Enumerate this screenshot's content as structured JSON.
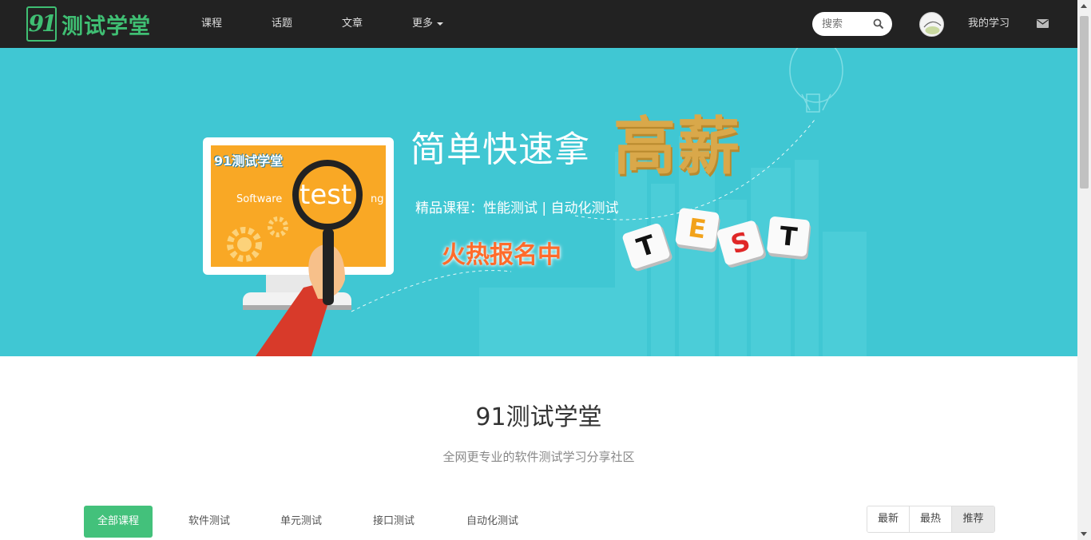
{
  "header": {
    "logo_text": "测试学堂",
    "logo_mark": "91",
    "nav": [
      "课程",
      "话题",
      "文章",
      "更多"
    ],
    "search_placeholder": "搜索",
    "my_study": "我的学习"
  },
  "banner": {
    "headline": "简单快速拿",
    "headline_big": "高薪",
    "subline": "精品课程：性能测试 | 自动化测试",
    "hot": "火热报名中",
    "screen_title": "91测试学堂",
    "screen_software": "Software",
    "screen_test": "test",
    "screen_ng": "ng",
    "tiles": [
      "T",
      "E",
      "S",
      "T"
    ]
  },
  "main": {
    "title": "91测试学堂",
    "subtitle": "全网更专业的软件测试学习分享社区",
    "categories": [
      "全部课程",
      "软件测试",
      "单元测试",
      "接口测试",
      "自动化测试"
    ],
    "sort": [
      "最新",
      "最热",
      "推荐"
    ]
  },
  "colors": {
    "nav_bg": "#222222",
    "brand_green": "#43c17b",
    "banner_bg": "#40c7d3",
    "gold": "#d9a84a"
  }
}
